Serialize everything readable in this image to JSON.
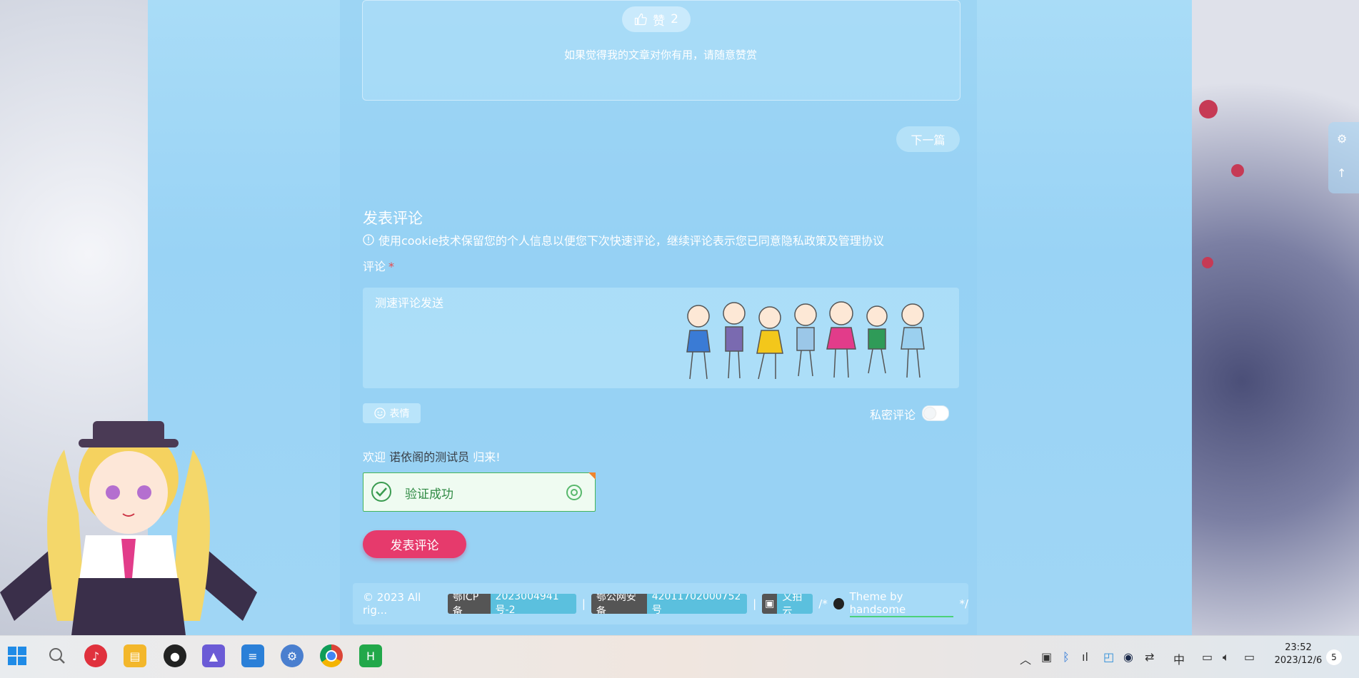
{
  "article": {
    "like_label": "赞",
    "like_count": "2",
    "like_text": "如果觉得我的文章对你有用，请随意赞赏",
    "next_label": "下一篇"
  },
  "comment": {
    "title": "发表评论",
    "cookie_notice": "使用cookie技术保留您的个人信息以便您下次快速评论，继续评论表示您已同意隐私政策及管理协议",
    "label": "评论",
    "required_mark": "*",
    "text": "测速评论发送",
    "emoji_label": "表情",
    "private_label": "私密评论",
    "private_enabled": false,
    "welcome_prefix": "欢迎",
    "user_name": "诺依阁的测试员",
    "welcome_suffix": "归来!",
    "verify_status": "验证成功",
    "submit_label": "发表评论"
  },
  "footer": {
    "copyright": "© 2023 All rig...",
    "icp_key": "鄂ICP备",
    "icp_value": "2023004941号-2",
    "sep": "|",
    "police_key": "鄂公网安备",
    "police_value": "42011702000752号",
    "cdn_label": "又拍云",
    "theme_prefix": "/*",
    "theme_text": "Theme by handsome",
    "theme_suffix": "*/"
  },
  "taskbar": {
    "time": "23:52",
    "date": "2023/12/6",
    "notifications": "5",
    "apps": [
      "start-icon",
      "search-icon",
      "netease-music-icon",
      "file-explorer-icon",
      "qq-icon",
      "photos-icon",
      "notepad-icon",
      "settings-app-icon",
      "chrome-icon",
      "hbuilder-icon"
    ],
    "tray": [
      "chevron-up-icon",
      "app-tray-icon",
      "bluetooth-icon",
      "meter-icon",
      "netease-tray-icon",
      "steam-icon",
      "tune-icon",
      "input-method-icon",
      "display-icon",
      "volume-icon",
      "battery-icon"
    ]
  },
  "colors": {
    "accent": "#e63a6c",
    "verify_green": "#44b55a",
    "panel_blue": "#99d3f5"
  }
}
